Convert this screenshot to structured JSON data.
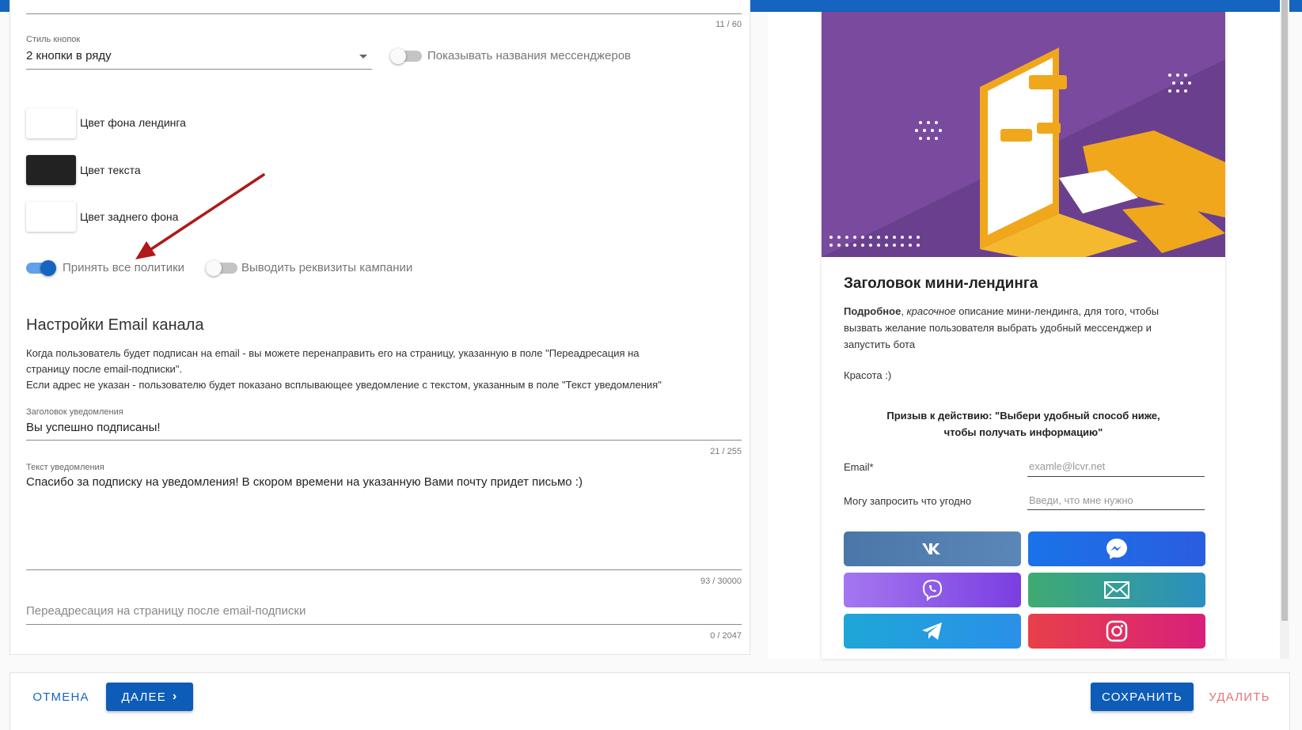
{
  "form": {
    "top_counter": "11 / 60",
    "button_style": {
      "label": "Стиль кнопок",
      "value": "2 кнопки в ряду"
    },
    "show_names_toggle": {
      "label": "Показывать названия мессенджеров",
      "on": false
    },
    "colors": [
      {
        "label": "Цвет фона лендинга",
        "color": "#ffffff"
      },
      {
        "label": "Цвет текста",
        "color": "#222222"
      },
      {
        "label": "Цвет заднего фона",
        "color": "#ffffff"
      }
    ],
    "accept_policies_toggle": {
      "label": "Принять все политики",
      "on": true
    },
    "show_requisites_toggle": {
      "label": "Выводить реквизиты кампании",
      "on": false
    },
    "email_section": {
      "title": "Настройки Email канала",
      "description_line1": "Когда пользователь будет подписан на email - вы можете перенаправить его на страницу, указанную в поле \"Переадресация на",
      "description_line2": "страницу после email-подписки\".",
      "description_line3": "Если адрес не указан - пользователю будет показано всплывающее уведомление с текстом, указанным в поле \"Текст уведомления\""
    },
    "notification_title": {
      "label": "Заголовок уведомления",
      "value": "Вы успешно подписаны!",
      "counter": "21 / 255"
    },
    "notification_text": {
      "label": "Текст уведомления",
      "value": "Спасибо за подписку на уведомления! В скором времени на указанную Вами почту придет письмо :)",
      "counter": "93 / 30000"
    },
    "redirect": {
      "placeholder": "Переадресация на страницу после email-подписки",
      "counter": "0 / 2047"
    }
  },
  "preview": {
    "title": "Заголовок мини-лендинга",
    "desc_bold": "Подробное",
    "desc_italic": "красочное",
    "desc_rest_line1": " описание мини-лендинга, для того, чтобы",
    "desc_line2": "вызвать желание пользователя выбрать удобный мессенджер и",
    "desc_line3": "запустить бота",
    "beauty": "Красота :)",
    "cta_line1": "Призыв к действию: \"Выбери удобный способ ниже,",
    "cta_line2": "чтобы получать информацию\"",
    "email_label": "Email*",
    "email_placeholder": "examle@lcvr.net",
    "ask_label": "Могу запросить что угодно",
    "ask_placeholder": "Введи, что мне нужно",
    "messengers": [
      {
        "name": "vk",
        "icon": "vk-icon",
        "color": "#4a76a8"
      },
      {
        "name": "messenger",
        "icon": "messenger-icon",
        "color": "#1877f2"
      },
      {
        "name": "viber",
        "icon": "viber-icon",
        "color": "#8e5ce8"
      },
      {
        "name": "email",
        "icon": "envelope-icon",
        "color": "#2f9f8f"
      },
      {
        "name": "telegram",
        "icon": "telegram-icon",
        "color": "#2aa3e0"
      },
      {
        "name": "instagram",
        "icon": "instagram-icon",
        "color": "#e1306c"
      }
    ]
  },
  "footer": {
    "cancel": "ОТМЕНА",
    "next": "ДАЛЕЕ",
    "save": "СОХРАНИТЬ",
    "delete": "УДАЛИТЬ"
  }
}
